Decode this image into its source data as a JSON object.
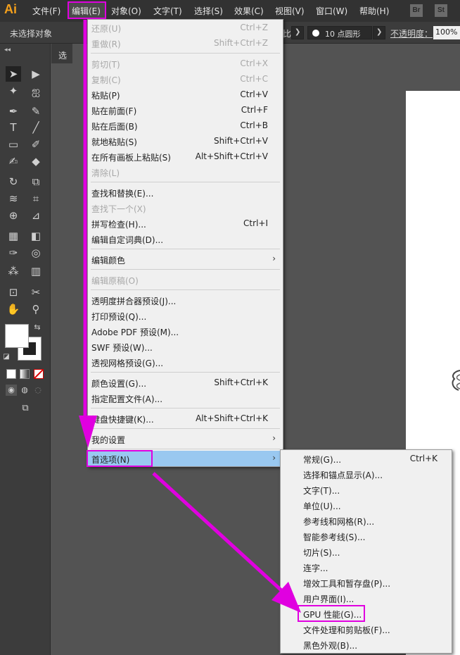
{
  "app": {
    "logo": "Ai"
  },
  "menubar": {
    "items": [
      {
        "label": "文件(F)"
      },
      {
        "label": "编辑(E)"
      },
      {
        "label": "对象(O)"
      },
      {
        "label": "文字(T)"
      },
      {
        "label": "选择(S)"
      },
      {
        "label": "效果(C)"
      },
      {
        "label": "视图(V)"
      },
      {
        "label": "窗口(W)"
      },
      {
        "label": "帮助(H)"
      }
    ],
    "badges": [
      "Br",
      "St"
    ]
  },
  "controlbar": {
    "no_selection": "未选择对象",
    "ratio_fragment": "比",
    "brush": "10 点圆形",
    "opacity_label": "不透明度：",
    "opacity_value": "100%"
  },
  "document": {
    "tab_label": "选"
  },
  "edit_menu": {
    "items": [
      {
        "label": "还原(U)",
        "shortcut": "Ctrl+Z",
        "disabled": true
      },
      {
        "label": "重做(R)",
        "shortcut": "Shift+Ctrl+Z",
        "disabled": true
      },
      {
        "label": "剪切(T)",
        "shortcut": "Ctrl+X",
        "disabled": true
      },
      {
        "label": "复制(C)",
        "shortcut": "Ctrl+C",
        "disabled": true
      },
      {
        "label": "粘贴(P)",
        "shortcut": "Ctrl+V"
      },
      {
        "label": "贴在前面(F)",
        "shortcut": "Ctrl+F"
      },
      {
        "label": "贴在后面(B)",
        "shortcut": "Ctrl+B"
      },
      {
        "label": "就地粘贴(S)",
        "shortcut": "Shift+Ctrl+V"
      },
      {
        "label": "在所有画板上粘贴(S)",
        "shortcut": "Alt+Shift+Ctrl+V"
      },
      {
        "label": "清除(L)",
        "shortcut": "",
        "disabled": true
      },
      {
        "label": "查找和替换(E)...",
        "shortcut": ""
      },
      {
        "label": "查找下一个(X)",
        "shortcut": "",
        "disabled": true
      },
      {
        "label": "拼写检查(H)...",
        "shortcut": "Ctrl+I"
      },
      {
        "label": "编辑自定词典(D)...",
        "shortcut": ""
      },
      {
        "label": "编辑颜色",
        "shortcut": ""
      },
      {
        "label": "编辑原稿(O)",
        "shortcut": "",
        "disabled": true
      },
      {
        "label": "透明度拼合器预设(J)...",
        "shortcut": ""
      },
      {
        "label": "打印预设(Q)...",
        "shortcut": ""
      },
      {
        "label": "Adobe PDF 预设(M)...",
        "shortcut": ""
      },
      {
        "label": "SWF 预设(W)...",
        "shortcut": ""
      },
      {
        "label": "透视网格预设(G)...",
        "shortcut": ""
      },
      {
        "label": "颜色设置(G)...",
        "shortcut": "Shift+Ctrl+K"
      },
      {
        "label": "指定配置文件(A)...",
        "shortcut": ""
      },
      {
        "label": "键盘快捷键(K)...",
        "shortcut": "Alt+Shift+Ctrl+K"
      },
      {
        "label": "我的设置",
        "shortcut": ""
      },
      {
        "label": "首选项(N)",
        "shortcut": ""
      }
    ]
  },
  "preferences_submenu": {
    "items": [
      {
        "label": "常规(G)...",
        "shortcut": "Ctrl+K"
      },
      {
        "label": "选择和锚点显示(A)...",
        "shortcut": ""
      },
      {
        "label": "文字(T)...",
        "shortcut": ""
      },
      {
        "label": "单位(U)...",
        "shortcut": ""
      },
      {
        "label": "参考线和网格(R)...",
        "shortcut": ""
      },
      {
        "label": "智能参考线(S)...",
        "shortcut": ""
      },
      {
        "label": "切片(S)...",
        "shortcut": ""
      },
      {
        "label": "连字...",
        "shortcut": ""
      },
      {
        "label": "增效工具和暂存盘(P)...",
        "shortcut": ""
      },
      {
        "label": "用户界面(I)...",
        "shortcut": ""
      },
      {
        "label": "GPU 性能(G)...",
        "shortcut": ""
      },
      {
        "label": "文件处理和剪贴板(F)...",
        "shortcut": ""
      },
      {
        "label": "黑色外观(B)...",
        "shortcut": ""
      }
    ]
  },
  "colors": {
    "highlight": "#99c8f0",
    "annotation": "#e000e0",
    "logo": "#f4a01c"
  }
}
